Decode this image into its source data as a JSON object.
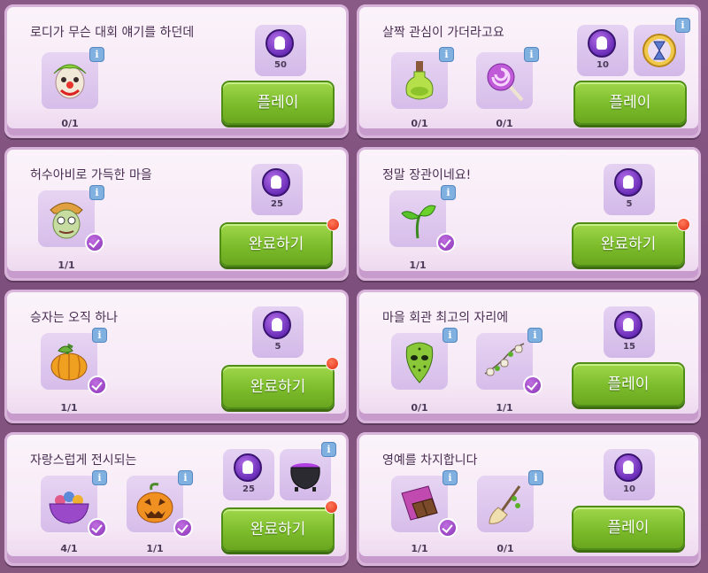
{
  "quests": [
    {
      "title": "로디가 무슨 대회 얘기를 하던데",
      "items": [
        {
          "icon": "clown-mask-icon",
          "count": "0/1",
          "completed": false
        }
      ],
      "rewards": [
        {
          "icon": "purple-ghost-coin-icon",
          "amount": "50"
        }
      ],
      "button": "플레이",
      "notification": false
    },
    {
      "title": "살짝 관심이 가더라고요",
      "items": [
        {
          "icon": "potion-bottle-icon",
          "count": "0/1",
          "completed": false
        },
        {
          "icon": "lollipop-icon",
          "count": "0/1",
          "completed": false
        }
      ],
      "rewards": [
        {
          "icon": "purple-ghost-coin-icon",
          "amount": "10"
        },
        {
          "icon": "hourglass-booster-icon",
          "amount": ""
        }
      ],
      "button": "플레이",
      "notification": false
    },
    {
      "title": "허수아비로 가득한 마을",
      "items": [
        {
          "icon": "scarecrow-mask-icon",
          "count": "1/1",
          "completed": true
        }
      ],
      "rewards": [
        {
          "icon": "purple-ghost-coin-icon",
          "amount": "25"
        }
      ],
      "button": "완료하기",
      "notification": true
    },
    {
      "title": "정말 장관이네요!",
      "items": [
        {
          "icon": "sprout-icon",
          "count": "1/1",
          "completed": true
        }
      ],
      "rewards": [
        {
          "icon": "purple-ghost-coin-icon",
          "amount": "5"
        }
      ],
      "button": "완료하기",
      "notification": true
    },
    {
      "title": "승자는 오직 하나",
      "items": [
        {
          "icon": "pumpkin-icon",
          "count": "1/1",
          "completed": true
        }
      ],
      "rewards": [
        {
          "icon": "purple-ghost-coin-icon",
          "amount": "5"
        }
      ],
      "button": "완료하기",
      "notification": true
    },
    {
      "title": "마을 회관 최고의 자리에",
      "items": [
        {
          "icon": "hockey-mask-icon",
          "count": "0/1",
          "completed": false
        },
        {
          "icon": "bone-garland-icon",
          "count": "1/1",
          "completed": true
        }
      ],
      "rewards": [
        {
          "icon": "purple-ghost-coin-icon",
          "amount": "15"
        }
      ],
      "button": "플레이",
      "notification": false
    },
    {
      "title": "자랑스럽게 전시되는",
      "items": [
        {
          "icon": "candy-bowl-icon",
          "count": "4/1",
          "completed": true
        },
        {
          "icon": "jack-o-lantern-icon",
          "count": "1/1",
          "completed": true
        }
      ],
      "rewards": [
        {
          "icon": "purple-ghost-coin-icon",
          "amount": "25"
        },
        {
          "icon": "cauldron-icon",
          "amount": ""
        }
      ],
      "button": "완료하기",
      "notification": true
    },
    {
      "title": "영예를 차지합니다",
      "items": [
        {
          "icon": "chocolate-bar-icon",
          "count": "1/1",
          "completed": true
        },
        {
          "icon": "broom-icon",
          "count": "0/1",
          "completed": false
        }
      ],
      "rewards": [
        {
          "icon": "purple-ghost-coin-icon",
          "amount": "10"
        }
      ],
      "button": "플레이",
      "notification": false
    }
  ]
}
